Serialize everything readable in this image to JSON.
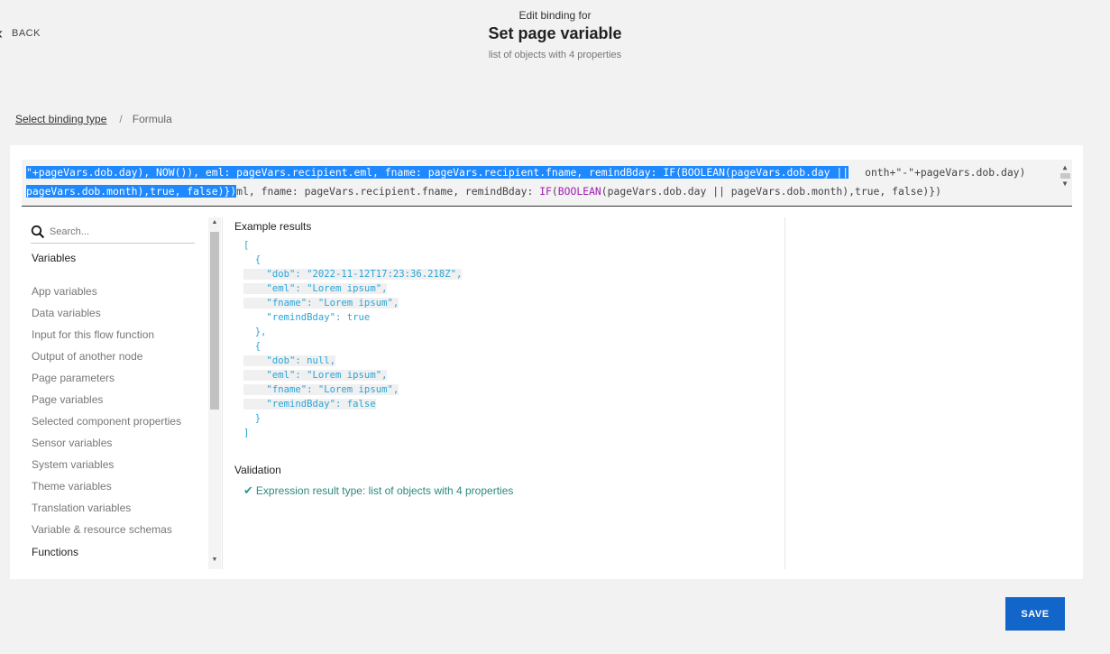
{
  "header": {
    "back_label": "BACK",
    "kicker": "Edit binding for",
    "title": "Set page variable",
    "subtitle": "list of objects with 4 properties"
  },
  "breadcrumb": {
    "link": "Select binding type",
    "separator": "/",
    "current": "Formula"
  },
  "formula": {
    "line1_selected": "\"+pageVars.dob.day), NOW()), eml: pageVars.recipient.eml, fname: pageVars.recipient.fname, remindBday: IF(BOOLEAN(pageVars.dob.day ||",
    "line1_rest": "onth+\"-\"+pageVars.dob.day)",
    "line2_selected": "pageVars.dob.month),true, false)})",
    "line2_rest_a": "ml, fname: pageVars.recipient.fname, remindBday: ",
    "line2_fn1": "IF",
    "line2_rest_b": "(",
    "line2_fn2": "BOOLEAN",
    "line2_rest_c": "(pageVars.dob.day || pageVars.dob.month),true, false)})"
  },
  "sidebar": {
    "search_placeholder": "Search...",
    "variables_heading": "Variables",
    "items": [
      "App variables",
      "Data variables",
      "Input for this flow function",
      "Output of another node",
      "Page parameters",
      "Page variables",
      "Selected component properties",
      "Sensor variables",
      "System variables",
      "Theme variables",
      "Translation variables",
      "Variable & resource schemas"
    ],
    "functions_heading": "Functions"
  },
  "results": {
    "heading": "Example results",
    "json_lines": [
      "[",
      "  {",
      "    \"dob\": \"2022-11-12T17:23:36.218Z\",",
      "    \"eml\": \"Lorem ipsum\",",
      "    \"fname\": \"Lorem ipsum\",",
      "    \"remindBday\": true",
      "  },",
      "  {",
      "    \"dob\": null,",
      "    \"eml\": \"Lorem ipsum\",",
      "    \"fname\": \"Lorem ipsum\",",
      "    \"remindBday\": false",
      "  }",
      "]"
    ]
  },
  "validation": {
    "heading": "Validation",
    "message": "Expression result type: list of objects with 4 properties"
  },
  "save_label": "SAVE",
  "colors": {
    "primary": "#1366c9",
    "selection": "#1e88ff",
    "success": "#2a9d8f",
    "json": "#2aa5d8"
  }
}
